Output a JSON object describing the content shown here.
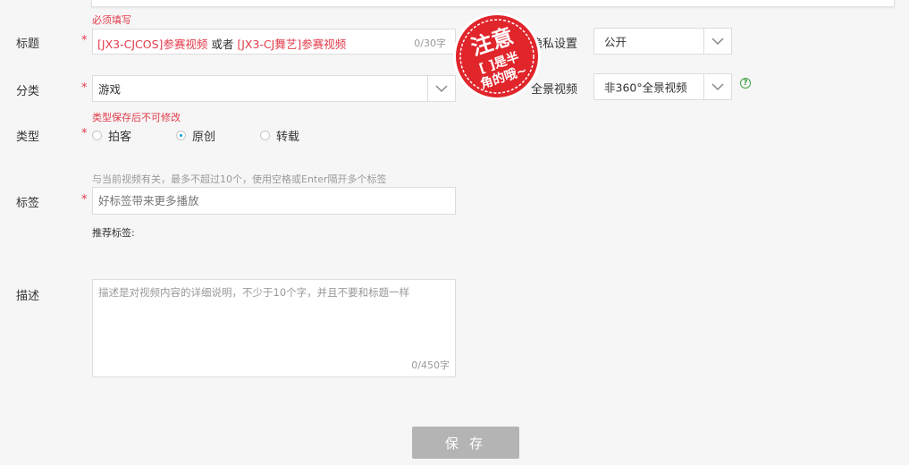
{
  "form": {
    "title": {
      "hint": "必须填写",
      "label": "标题",
      "required_mark": "*",
      "value_part1": "[JX3-CJCOS]参赛视频",
      "value_or": " 或者 ",
      "value_part2": "[JX3-CJ舞艺]参赛视频",
      "counter": "0/30字"
    },
    "privacy": {
      "label": "隐私设置",
      "value": "公开"
    },
    "category": {
      "label": "分类",
      "required_mark": "*",
      "value": "游戏"
    },
    "panorama": {
      "label": "全景视频",
      "value": "非360°全景视频",
      "help": "?"
    },
    "type": {
      "hint": "类型保存后不可修改",
      "label": "类型",
      "required_mark": "*",
      "options": [
        "拍客",
        "原创",
        "转载"
      ],
      "selected": "原创"
    },
    "tags": {
      "hint": "与当前视频有关，最多不超过10个，使用空格或Enter隔开多个标签",
      "label": "标签",
      "required_mark": "*",
      "placeholder": "好标签带来更多播放",
      "recommend_label": "推荐标签:"
    },
    "description": {
      "label": "描述",
      "placeholder": "描述是对视频内容的详细说明，不少于10个字，并且不要和标题一样",
      "counter": "0/450字"
    },
    "save_label": "保 存"
  },
  "stamp": {
    "line1": "注意",
    "line2": "[ ]是半",
    "line3": "角的哦~"
  },
  "colors": {
    "required": "#e23a4a",
    "stamp_red": "#e0252b",
    "radio_accent": "#00a1d6",
    "save_button": "#b4b4b4",
    "help_green": "#43a047"
  }
}
